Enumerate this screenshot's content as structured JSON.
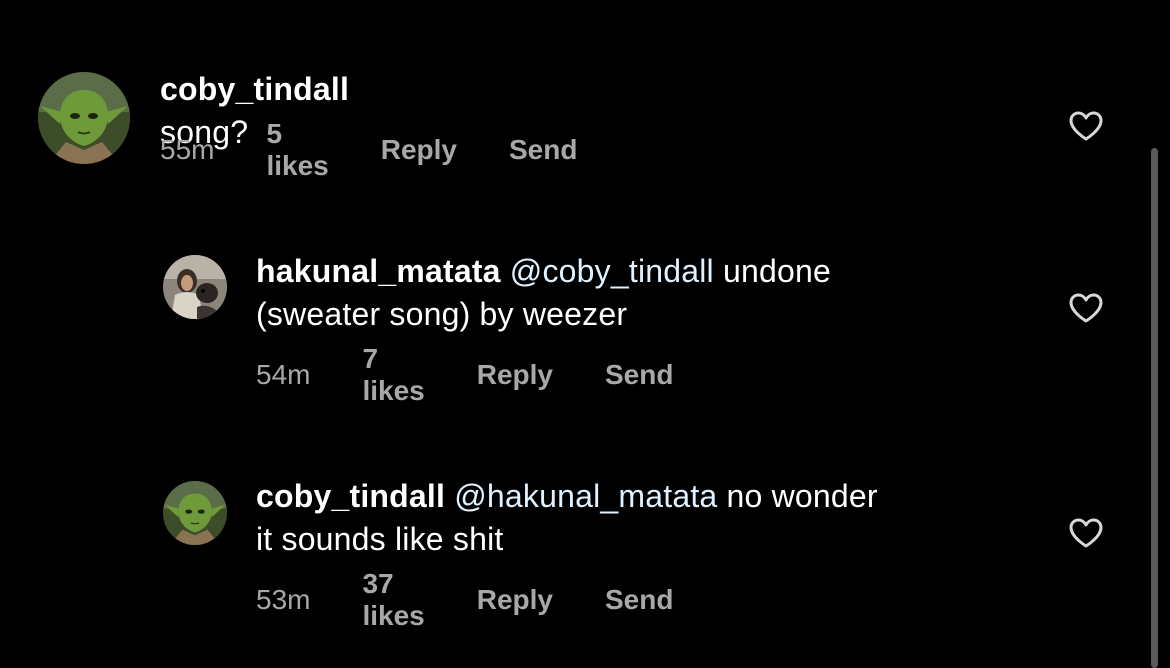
{
  "comments": [
    {
      "username": "coby_tindall",
      "text": "song?",
      "mention": "",
      "text_line2": "",
      "time": "55m",
      "likes": "5 likes",
      "reply": "Reply",
      "send": "Send",
      "avatar_icon": "yoda-avatar"
    },
    {
      "username": "hakunal_matata",
      "mention": "@coby_tindall",
      "text": "undone",
      "text_line2": "(sweater song) by weezer",
      "time": "54m",
      "likes": "7 likes",
      "reply": "Reply",
      "send": "Send",
      "avatar_icon": "person-with-dog-avatar"
    },
    {
      "username": "coby_tindall",
      "mention": "@hakunal_matata",
      "text": "no wonder",
      "text_line2": "it sounds like shit",
      "time": "53m",
      "likes": "37 likes",
      "reply": "Reply",
      "send": "Send",
      "avatar_icon": "yoda-avatar"
    }
  ],
  "colors": {
    "background": "#000000",
    "text": "#ffffff",
    "meta": "#a8a8a8",
    "mention": "#e0f1ff"
  }
}
